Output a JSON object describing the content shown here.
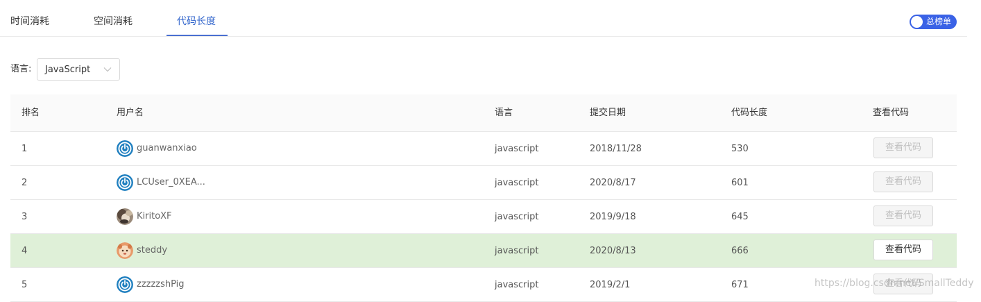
{
  "tabs": [
    {
      "label": "时间消耗",
      "active": false
    },
    {
      "label": "空间消耗",
      "active": false
    },
    {
      "label": "代码长度",
      "active": true
    }
  ],
  "toggle": {
    "label": "总榜单",
    "on": true,
    "color": "#3a62e6"
  },
  "filter": {
    "label": "语言:",
    "selected": "JavaScript",
    "arrow_icon": "chevron-down-icon"
  },
  "table": {
    "headers": {
      "rank": "排名",
      "user": "用户名",
      "lang": "语言",
      "date": "提交日期",
      "length": "代码长度",
      "view": "查看代码"
    },
    "rows": [
      {
        "rank": "1",
        "user": "guanwanxiao",
        "avatar": "power-avatar-icon",
        "lang": "javascript",
        "date": "2018/11/28",
        "length": "530",
        "view_label": "查看代码",
        "view_enabled": false,
        "highlight": false
      },
      {
        "rank": "2",
        "user": "LCUser_0XEA...",
        "avatar": "power-avatar-icon",
        "lang": "javascript",
        "date": "2020/8/17",
        "length": "601",
        "view_label": "查看代码",
        "view_enabled": false,
        "highlight": false
      },
      {
        "rank": "3",
        "user": "KiritoXF",
        "avatar": "photo-avatar",
        "lang": "javascript",
        "date": "2019/9/18",
        "length": "645",
        "view_label": "查看代码",
        "view_enabled": false,
        "highlight": false
      },
      {
        "rank": "4",
        "user": "steddy",
        "avatar": "cartoon-avatar",
        "lang": "javascript",
        "date": "2020/8/13",
        "length": "666",
        "view_label": "查看代码",
        "view_enabled": true,
        "highlight": true
      },
      {
        "rank": "5",
        "user": "zzzzzshPig",
        "avatar": "power-avatar-icon",
        "lang": "javascript",
        "date": "2019/2/1",
        "length": "671",
        "view_label": "查看代码",
        "view_enabled": false,
        "highlight": false
      }
    ]
  },
  "colors": {
    "accent": "#3366cc",
    "highlight_row": "#dff0d8",
    "power_icon": "#1f7fbf"
  },
  "watermark": "https://blog.csdn.net/SmallTeddy"
}
